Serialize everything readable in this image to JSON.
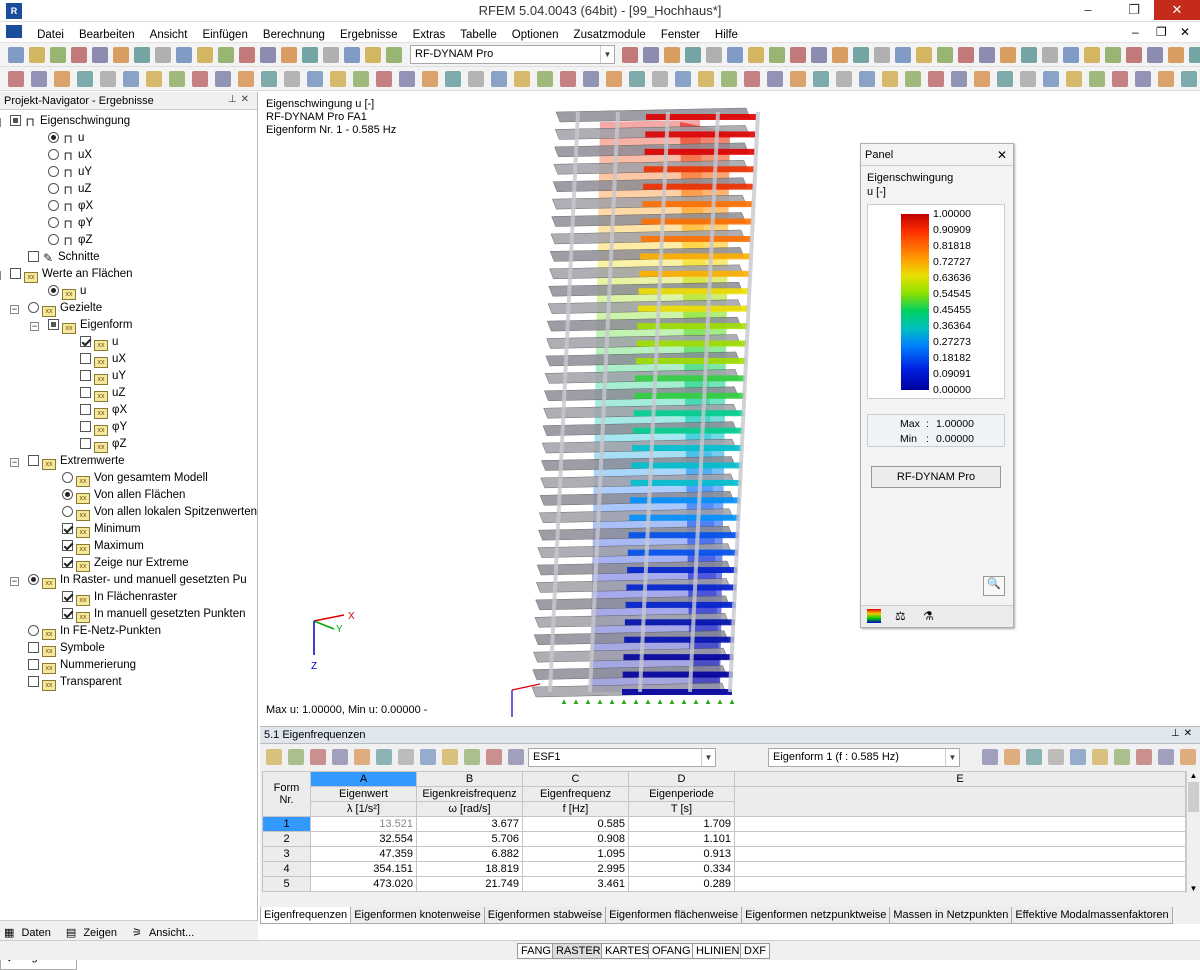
{
  "window": {
    "title": "RFEM 5.04.0043 (64bit) - [99_Hochhaus*]",
    "min": "–",
    "max": "❐",
    "close": "✕"
  },
  "menu": [
    "Datei",
    "Bearbeiten",
    "Ansicht",
    "Einfügen",
    "Berechnung",
    "Ergebnisse",
    "Extras",
    "Tabelle",
    "Optionen",
    "Zusatzmodule",
    "Fenster",
    "Hilfe"
  ],
  "menu_doc_controls": {
    "min": "–",
    "restore": "❐",
    "close": "✕"
  },
  "toolbar": {
    "module_combo": "RF-DYNAM Pro"
  },
  "navigator": {
    "title": "Projekt-Navigator - Ergebnisse",
    "tree": [
      {
        "label": "Eigenschwingung"
      },
      {
        "label": "u"
      },
      {
        "label": "uX"
      },
      {
        "label": "uY"
      },
      {
        "label": "uZ"
      },
      {
        "label": "φX"
      },
      {
        "label": "φY"
      },
      {
        "label": "φZ"
      },
      {
        "label": "Schnitte"
      },
      {
        "label": "Werte an Flächen"
      },
      {
        "label": "u"
      },
      {
        "label": "Gezielte"
      },
      {
        "label": "Eigenform"
      },
      {
        "label": "u"
      },
      {
        "label": "uX"
      },
      {
        "label": "uY"
      },
      {
        "label": "uZ"
      },
      {
        "label": "φX"
      },
      {
        "label": "φY"
      },
      {
        "label": "φZ"
      },
      {
        "label": "Extremwerte"
      },
      {
        "label": "Von gesamtem Modell"
      },
      {
        "label": "Von allen Flächen"
      },
      {
        "label": "Von allen lokalen Spitzenwerten"
      },
      {
        "label": "Minimum"
      },
      {
        "label": "Maximum"
      },
      {
        "label": "Zeige nur Extreme"
      },
      {
        "label": "In Raster- und manuell gesetzten Pu"
      },
      {
        "label": "In Flächenraster"
      },
      {
        "label": "In manuell gesetzten Punkten"
      },
      {
        "label": "In FE-Netz-Punkten"
      },
      {
        "label": "Symbole"
      },
      {
        "label": "Nummerierung"
      },
      {
        "label": "Transparent"
      }
    ],
    "tabs": [
      "Daten",
      "Zeigen",
      "Ansicht...",
      "Ergebni..."
    ]
  },
  "view": {
    "line1": "Eigenschwingung u [-]",
    "line2": "RF-DYNAM Pro FA1",
    "line3": "Eigenform Nr. 1 - 0.585 Hz",
    "bottom": "Max u: 1.00000, Min u: 0.00000 -",
    "axis_x": "X",
    "axis_y": "Y",
    "axis_z": "Z"
  },
  "panel": {
    "title": "Panel",
    "close": "✕",
    "heading": "Eigenschwingung",
    "unit": "u [-]",
    "legend": [
      "1.00000",
      "0.90909",
      "0.81818",
      "0.72727",
      "0.63636",
      "0.54545",
      "0.45455",
      "0.36364",
      "0.27273",
      "0.18182",
      "0.09091",
      "0.00000"
    ],
    "max_label": "Max",
    "max_value": "1.00000",
    "min_label": "Min",
    "min_value": "0.00000",
    "button": "RF-DYNAM Pro"
  },
  "table": {
    "title": "5.1 Eigenfrequenzen",
    "combo1": "ESF1",
    "combo2": "Eigenform 1 (f : 0.585 Hz)",
    "col_letters": [
      "A",
      "B",
      "C",
      "D",
      "E"
    ],
    "head_form": "Form",
    "head_nr": "Nr.",
    "headers": [
      {
        "l1": "Eigenwert",
        "l2": "λ [1/s²]"
      },
      {
        "l1": "Eigenkreisfrequenz",
        "l2": "ω [rad/s]"
      },
      {
        "l1": "Eigenfrequenz",
        "l2": "f [Hz]"
      },
      {
        "l1": "Eigenperiode",
        "l2": "T [s]"
      }
    ],
    "rows": [
      [
        "1",
        "13.521",
        "3.677",
        "0.585",
        "1.709"
      ],
      [
        "2",
        "32.554",
        "5.706",
        "0.908",
        "1.101"
      ],
      [
        "3",
        "47.359",
        "6.882",
        "1.095",
        "0.913"
      ],
      [
        "4",
        "354.151",
        "18.819",
        "2.995",
        "0.334"
      ],
      [
        "5",
        "473.020",
        "21.749",
        "3.461",
        "0.289"
      ]
    ],
    "tabs": [
      "Eigenfrequenzen",
      "Eigenformen knotenweise",
      "Eigenformen stabweise",
      "Eigenformen flächenweise",
      "Eigenformen netzpunktweise",
      "Massen in Netzpunkten",
      "Effektive Modalmassenfaktoren"
    ]
  },
  "status": [
    "FANG",
    "RASTER",
    "KARTES",
    "OFANG",
    "HLINIEN",
    "DXF"
  ],
  "colors": {
    "accent": "#1a4e9c",
    "selection": "#3399ff",
    "close": "#c42b1c"
  }
}
